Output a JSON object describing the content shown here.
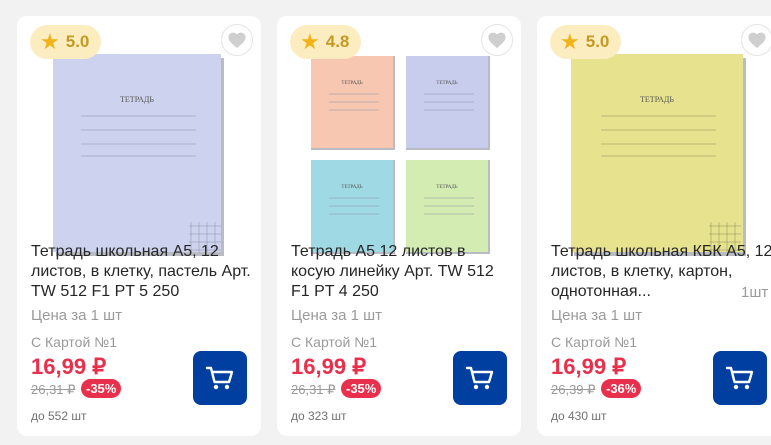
{
  "products": [
    {
      "rating": "5.0",
      "title": "Тетрадь школьная А5, 12 листов, в клетку, пастель Арт. TW 512 F1 PT 5 250",
      "unit_label": "Цена за 1 шт",
      "card_label": "С Картой №1",
      "price": "16,99 ₽",
      "old_price": "26,31 ₽",
      "discount": "-35%",
      "stock": "до 552 шт",
      "cover_label": "ТЕТРАДЬ",
      "cover_color": "#cdd3ee"
    },
    {
      "rating": "4.8",
      "title": "Тетрадь А5 12 листов в косую линейку Арт. TW 512 F1 PT 4 250",
      "unit_label": "Цена за 1 шт",
      "card_label": "С Картой №1",
      "price": "16,99 ₽",
      "old_price": "26,31 ₽",
      "discount": "-35%",
      "stock": "до 323 шт",
      "cover_label": "ТЕТРАДЬ",
      "cover_colors": [
        "#f7c7b2",
        "#c8cdee",
        "#9fd9e3",
        "#d3ecb2"
      ]
    },
    {
      "rating": "5.0",
      "title": "Тетрадь школьная КБК А5, 12 листов, в клетку, картон, однотонная...",
      "qty": "1шт",
      "unit_label": "Цена за 1 шт",
      "card_label": "С Картой №1",
      "price": "16,99 ₽",
      "old_price": "26,39 ₽",
      "discount": "-36%",
      "stock": "до 430 шт",
      "cover_label": "ТЕТРАДЬ",
      "cover_color": "#e6e28e"
    }
  ],
  "icons": {
    "star": "star-icon",
    "favorite": "heart-icon",
    "cart": "cart-icon"
  },
  "colors": {
    "accent": "#003f9f",
    "price": "#e8304c",
    "rating_bg": "#fbedc0",
    "star": "#f2b319"
  }
}
